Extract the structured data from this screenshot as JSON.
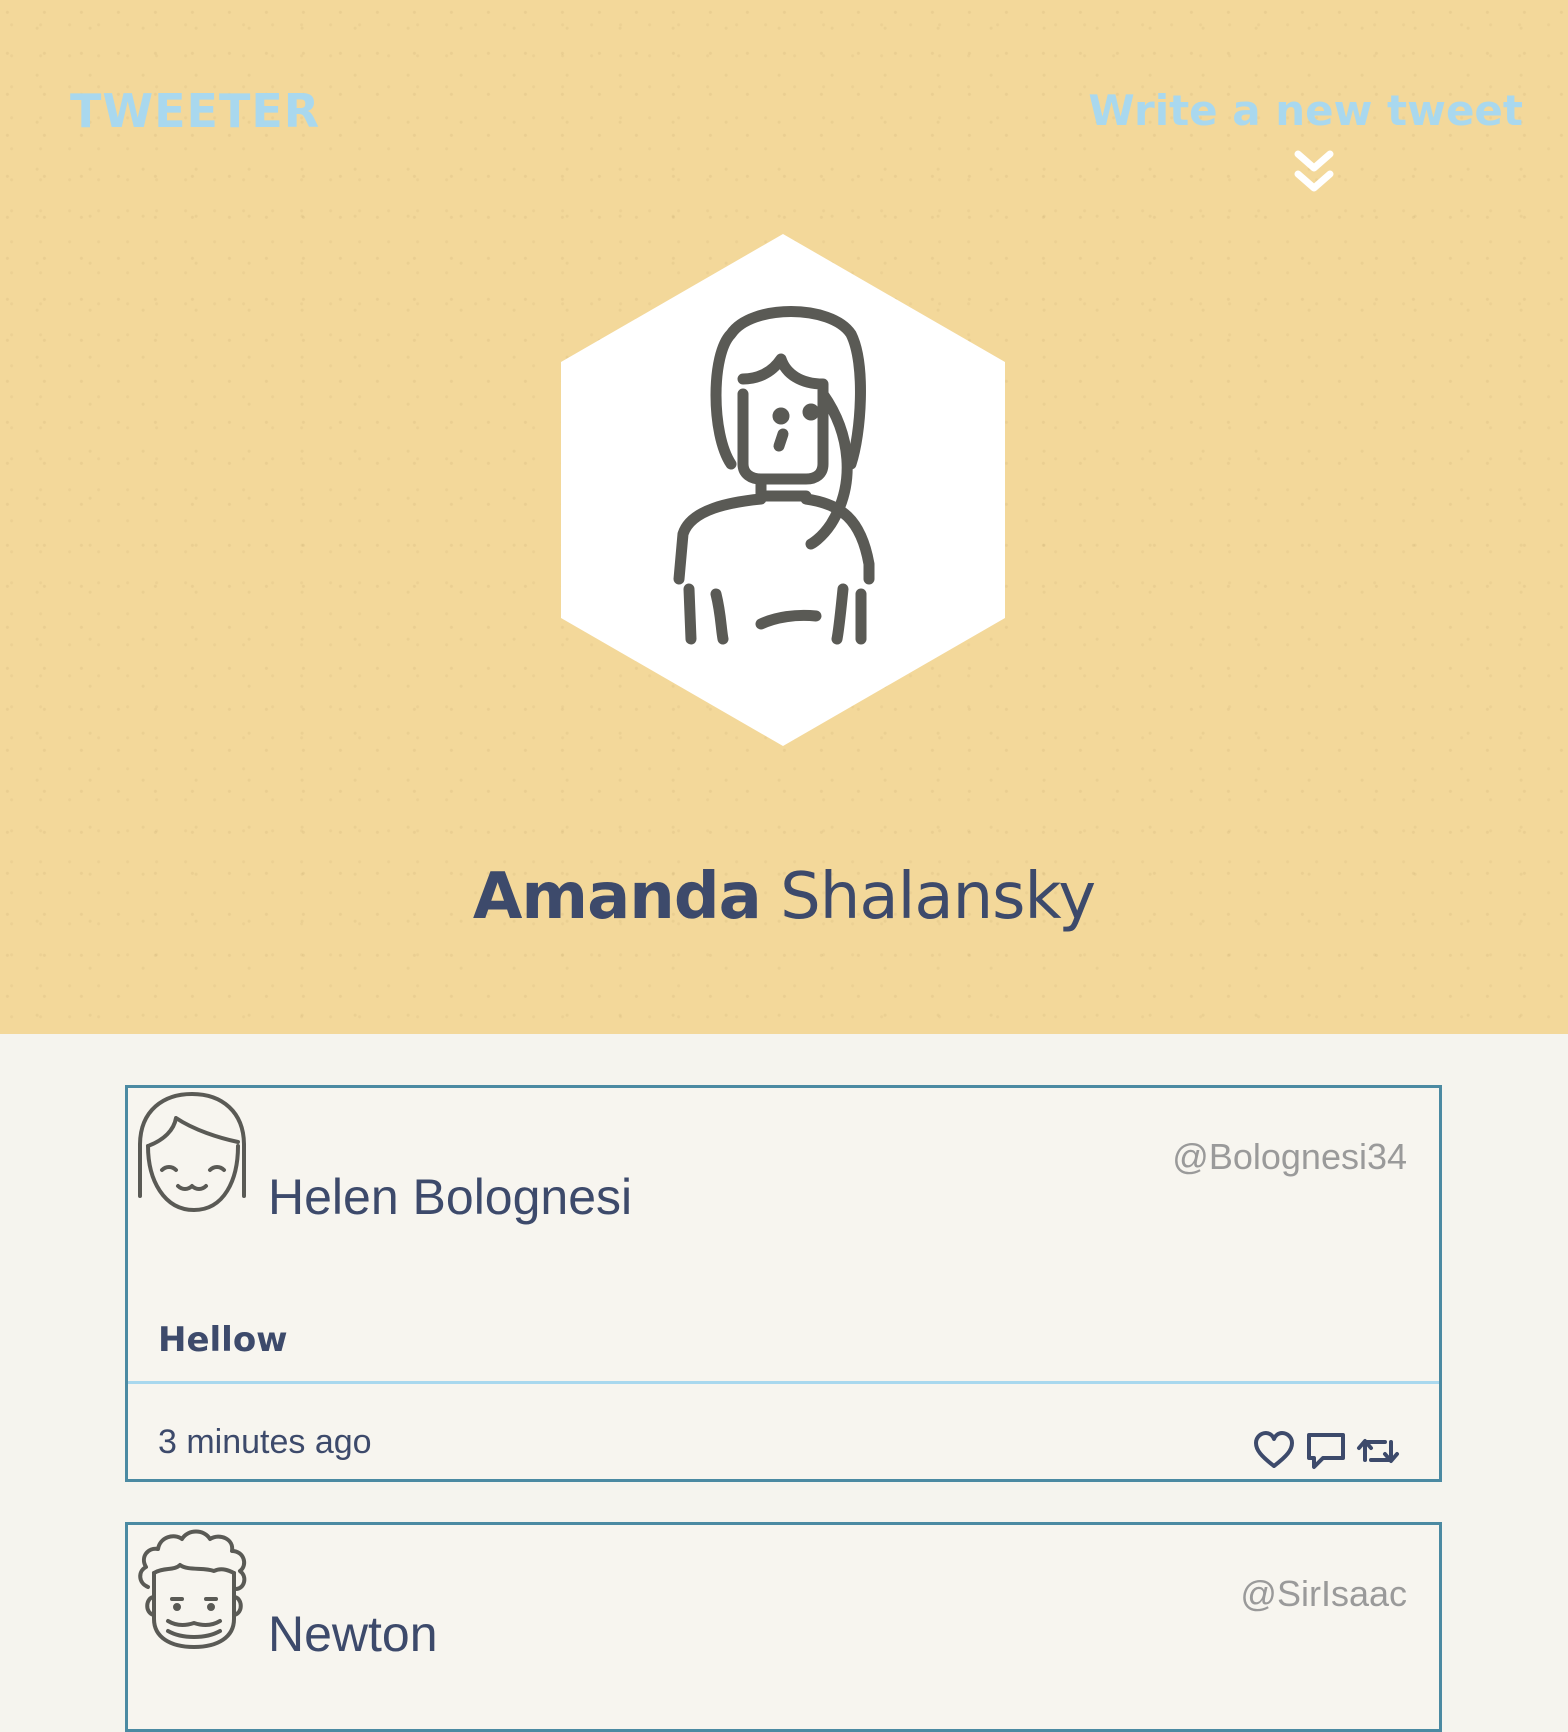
{
  "header": {
    "brand": "TWEETER",
    "compose_link": "Write a new tweet",
    "colors": {
      "accent": "#a9d8ee",
      "hero_bg": "#f3d89a",
      "text": "#3d4a6b"
    }
  },
  "profile": {
    "first_name": "Amanda",
    "last_name": "Shalansky",
    "avatar_icon": "woman-avatar-icon"
  },
  "tweets": [
    {
      "name": "Helen Bolognesi",
      "handle": "@Bolognesi34",
      "body": "Hellow",
      "time": "3 minutes ago",
      "avatar_icon": "girl-avatar-icon"
    },
    {
      "name": "Newton",
      "handle": "@SirIsaac",
      "avatar_icon": "curly-hair-avatar-icon"
    }
  ],
  "actions": [
    "heart-icon",
    "comment-icon",
    "retweet-icon"
  ]
}
